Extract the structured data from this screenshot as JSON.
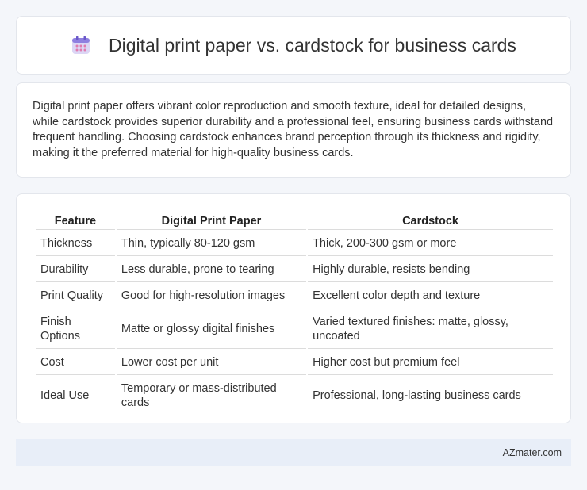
{
  "header": {
    "title": "Digital print paper vs. cardstock for business cards",
    "icon": "calendar-icon"
  },
  "summary": {
    "text": "Digital print paper offers vibrant color reproduction and smooth texture, ideal for detailed designs, while cardstock provides superior durability and a professional feel, ensuring business cards withstand frequent handling. Choosing cardstock enhances brand perception through its thickness and rigidity, making it the preferred material for high-quality business cards."
  },
  "table": {
    "headers": [
      "Feature",
      "Digital Print Paper",
      "Cardstock"
    ],
    "rows": [
      [
        "Thickness",
        "Thin, typically 80-120 gsm",
        "Thick, 200-300 gsm or more"
      ],
      [
        "Durability",
        "Less durable, prone to tearing",
        "Highly durable, resists bending"
      ],
      [
        "Print Quality",
        "Good for high-resolution images",
        "Excellent color depth and texture"
      ],
      [
        "Finish Options",
        "Matte or glossy digital finishes",
        "Varied textured finishes: matte, glossy, uncoated"
      ],
      [
        "Cost",
        "Lower cost per unit",
        "Higher cost but premium feel"
      ],
      [
        "Ideal Use",
        "Temporary or mass-distributed cards",
        "Professional, long-lasting business cards"
      ]
    ]
  },
  "footer": {
    "text": "AZmater.com"
  }
}
